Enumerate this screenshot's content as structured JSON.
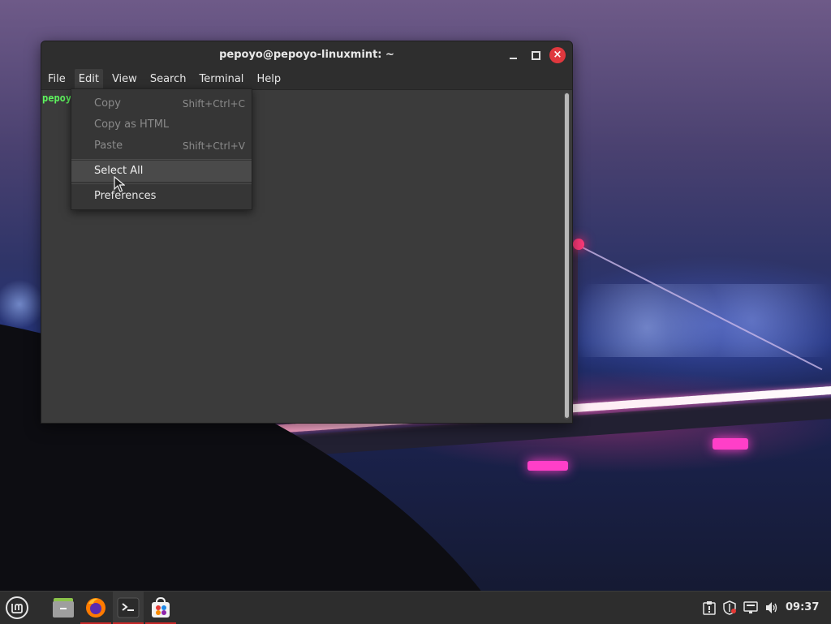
{
  "window": {
    "title": "pepoyo@pepoyo-linuxmint: ~",
    "buttons": {
      "minimize": "minimize",
      "maximize": "maximize",
      "close": "×"
    }
  },
  "menubar": {
    "items": [
      {
        "label": "File"
      },
      {
        "label": "Edit"
      },
      {
        "label": "View"
      },
      {
        "label": "Search"
      },
      {
        "label": "Terminal"
      },
      {
        "label": "Help"
      }
    ],
    "active": "Edit"
  },
  "terminal": {
    "prompt_visible": "pepoy"
  },
  "edit_menu": {
    "items": [
      {
        "label": "Copy",
        "accel": "Shift+Ctrl+C",
        "enabled": false
      },
      {
        "label": "Copy as HTML",
        "accel": "",
        "enabled": false
      },
      {
        "label": "Paste",
        "accel": "Shift+Ctrl+V",
        "enabled": false
      },
      {
        "label": "Select All",
        "accel": "",
        "enabled": true,
        "hovered": true
      },
      {
        "label": "Preferences",
        "accel": "",
        "enabled": true
      }
    ]
  },
  "taskbar": {
    "menu_icon": "mint-menu-icon",
    "apps": [
      {
        "icon": "files-icon",
        "running": false
      },
      {
        "icon": "firefox-icon",
        "running": true
      },
      {
        "icon": "terminal-icon",
        "running": true,
        "focused": true
      },
      {
        "icon": "software-manager-icon",
        "running": true
      }
    ],
    "tray": [
      "update-manager-icon",
      "shield-icon",
      "network-icon",
      "volume-icon"
    ],
    "clock": "09:37"
  },
  "colors": {
    "prompt_green": "#5ef35e",
    "close_red": "#e0383e",
    "running_indicator": "#c62828"
  }
}
